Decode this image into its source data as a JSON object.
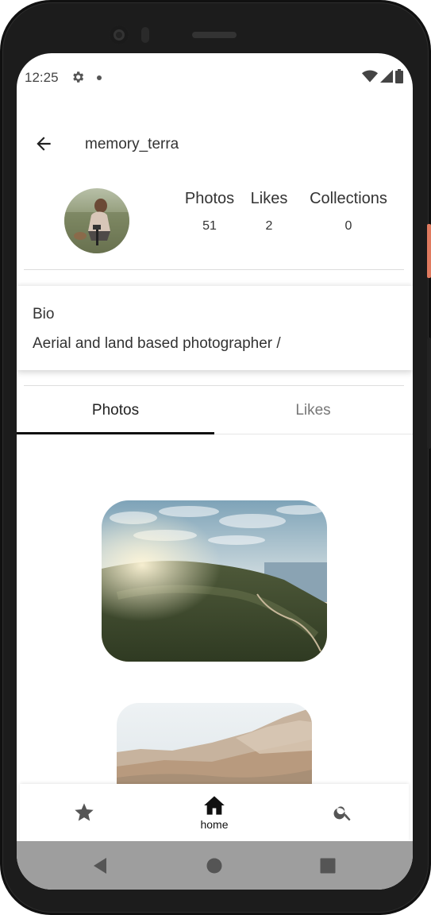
{
  "status_bar": {
    "time": "12:25",
    "icons": [
      "settings-gear-icon",
      "notification-dot-icon",
      "wifi-icon",
      "signal-icon",
      "battery-icon"
    ]
  },
  "app_bar": {
    "back_icon": "arrow-back-icon",
    "title": "memory_terra"
  },
  "profile": {
    "avatar": "profile-photo-photographer",
    "stats": [
      {
        "label": "Photos",
        "value": "51"
      },
      {
        "label": "Likes",
        "value": "2"
      },
      {
        "label": "Collections",
        "value": "0"
      }
    ]
  },
  "bio": {
    "title": "Bio",
    "text": "Aerial and land based photographer /"
  },
  "tabs": {
    "items": [
      {
        "label": "Photos",
        "active": true
      },
      {
        "label": "Likes",
        "active": false
      }
    ]
  },
  "photos": [
    {
      "name": "aerial-coastal-mountains-sunset"
    },
    {
      "name": "rocky-desert-mountains"
    }
  ],
  "bottom_nav": {
    "items": [
      {
        "icon": "star-icon",
        "label": ""
      },
      {
        "icon": "home-icon",
        "label": "home"
      },
      {
        "icon": "search-icon",
        "label": ""
      }
    ]
  },
  "system_nav": {
    "icons": [
      "back-triangle-icon",
      "home-circle-icon",
      "recents-square-icon"
    ]
  },
  "colors": {
    "accent_side_button": "#e07a5f",
    "tab_indicator": "#111111",
    "system_nav_bg": "#9e9e9e"
  }
}
